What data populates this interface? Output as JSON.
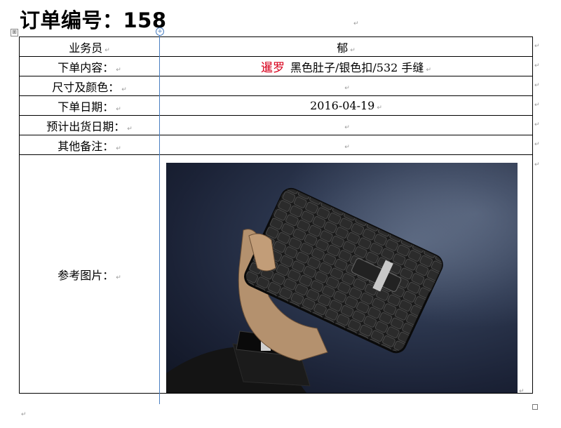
{
  "document": {
    "title": "订单编号：158"
  },
  "rows": [
    {
      "label": "业务员",
      "value": "郁"
    },
    {
      "label": "下单内容：",
      "brand": "暹罗",
      "value": "黑色肚子/银色扣/532 手缝"
    },
    {
      "label": "尺寸及颜色：",
      "value": ""
    },
    {
      "label": "下单日期：",
      "value": "2016-04-19"
    },
    {
      "label": "预计出货日期：",
      "value": ""
    },
    {
      "label": "其他备注：",
      "value": ""
    },
    {
      "label": "参考图片："
    }
  ],
  "marks": {
    "paragraph": "↵",
    "move": "⊞",
    "col": "+"
  },
  "image": {
    "subject": "black-crocodile-leather-wallet-in-hand"
  }
}
